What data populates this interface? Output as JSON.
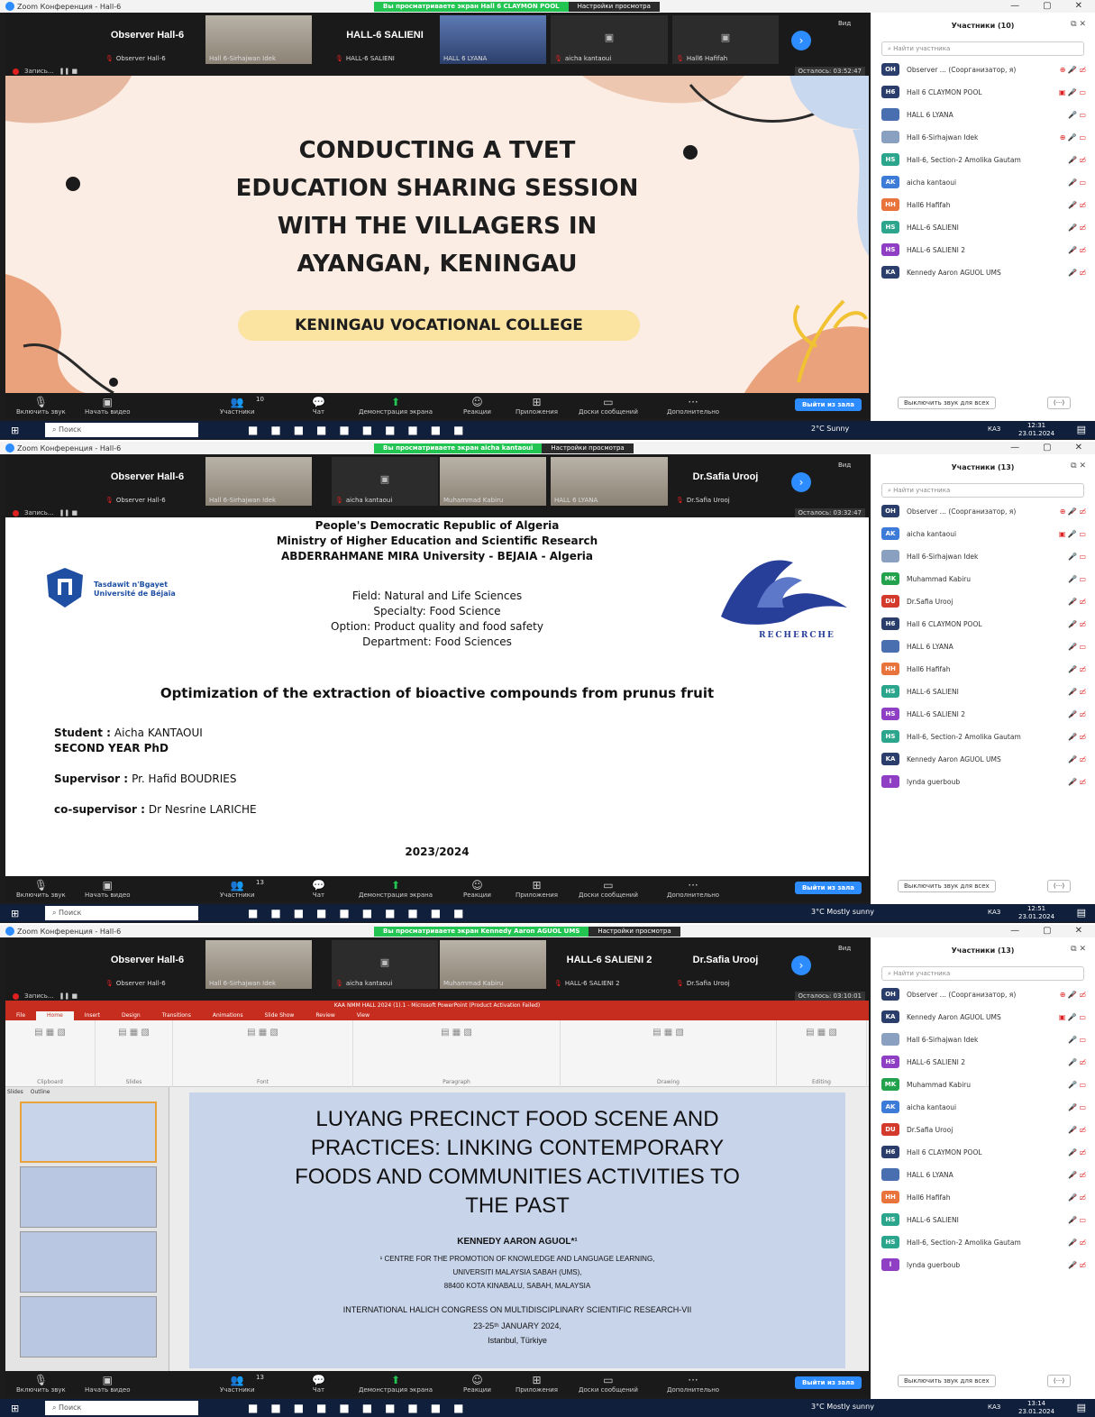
{
  "app_title": "Zoom Конференция - Hall-6",
  "window_controls": [
    "—",
    "▢",
    "✕"
  ],
  "screens": [
    {
      "banner": "Вы просматриваете экран Hall 6 CLAYMON POOL",
      "view_options": "Настройки просмотра",
      "gallery": [
        {
          "name": "Observer Hall-6",
          "sub": "Observer Hall-6",
          "cam": false
        },
        {
          "name": "",
          "sub": "Hall 6-Sirhajwan Idek",
          "cam": true
        },
        {
          "name": "HALL-6 SALIENI",
          "sub": "HALL-6 SALIENI",
          "cam": false
        },
        {
          "name": "",
          "sub": "HALL 6 LYANA",
          "cam": true
        },
        {
          "name": "",
          "sub": "aicha kantaoui",
          "cam": false
        },
        {
          "name": "",
          "sub": "Hall6 Hafifah",
          "cam": false
        }
      ],
      "view_label": "Вид",
      "recording": "Запись...",
      "remaining": "Осталось: 03:52:47",
      "slide": {
        "title_lines": [
          "CONDUCTING A TVET",
          "EDUCATION SHARING SESSION",
          "WITH THE VILLAGERS IN",
          "AYANGAN, KENINGAU"
        ],
        "pill": "KENINGAU VOCATIONAL COLLEGE"
      },
      "participants_title": "Участники (10)",
      "participants": [
        {
          "initials": "OH",
          "color": "#2b3e6b",
          "name": "Observer ... (Соорганизатор, я)",
          "status": "⊕ 🎤̸ ▭̸"
        },
        {
          "initials": "H6",
          "color": "#2b3e6b",
          "name": "Hall 6 CLAYMON POOL",
          "status": "▣ 🎤̸ ▭"
        },
        {
          "initials": "",
          "color": "#4a6fb0",
          "name": "HALL 6 LYANA",
          "status": "🎤 ▭"
        },
        {
          "initials": "",
          "color": "#8aa0c0",
          "name": "Hall 6-Sirhajwan Idek",
          "status": "⊕ 🎤 ▭"
        },
        {
          "initials": "HS",
          "color": "#2ca58d",
          "name": "Hall-6, Section-2 Amolika Gautam",
          "status": "🎤̸ ▭̸"
        },
        {
          "initials": "AK",
          "color": "#3d7bd9",
          "name": "aicha kantaoui",
          "status": "🎤̸ ▭"
        },
        {
          "initials": "HH",
          "color": "#e8743b",
          "name": "Hall6 Hafifah",
          "status": "🎤̸ ▭̸"
        },
        {
          "initials": "HS",
          "color": "#2ca58d",
          "name": "HALL-6 SALIENI",
          "status": "🎤̸ ▭̸"
        },
        {
          "initials": "HS",
          "color": "#8e3fc4",
          "name": "HALL-6 SALIENI 2",
          "status": "🎤̸ ▭̸"
        },
        {
          "initials": "KA",
          "color": "#2b3e6b",
          "name": "Kennedy Aaron AGUOL UMS",
          "status": "🎤̸ ▭̸"
        }
      ],
      "participants_count": "10",
      "weather": "2°C Sunny",
      "time": "12:31",
      "date": "23.01.2024"
    },
    {
      "banner": "Вы просматриваете экран aicha kantaoui",
      "view_options": "Настройки просмотра",
      "gallery": [
        {
          "name": "Observer Hall-6",
          "sub": "Observer Hall-6",
          "cam": false
        },
        {
          "name": "",
          "sub": "Hall 6-Sirhajwan Idek",
          "cam": true
        },
        {
          "name": "",
          "sub": "aicha kantaoui",
          "cam": false
        },
        {
          "name": "",
          "sub": "Muhammad Kabiru",
          "cam": true
        },
        {
          "name": "",
          "sub": "HALL 6 LYANA",
          "cam": true
        },
        {
          "name": "Dr.Safia Urooj",
          "sub": "Dr.Safia Urooj",
          "cam": false
        }
      ],
      "view_label": "Вид",
      "recording": "Запись...",
      "remaining": "Осталось: 03:32:47",
      "slide": {
        "header": [
          "People's Democratic Republic of Algeria",
          "Ministry of Higher Education and Scientific Research",
          "ABDERRAHMANE MIRA University - BEJAIA - Algeria"
        ],
        "logo_text": "Tasdawit n'Bgayet Université de Béjaïa",
        "field": [
          "Field: Natural and Life Sciences",
          "Specialty: Food Science",
          "Option: Product quality and food safety",
          "Department: Food Sciences"
        ],
        "recherche": "RECHERCHE",
        "title": "Optimization of the extraction of bioactive compounds from prunus fruit",
        "student_label": "Student :",
        "student": "Aicha KANTAOUI",
        "year": "SECOND YEAR PhD",
        "supervisor_label": "Supervisor :",
        "supervisor": "Pr. Hafid BOUDRIES",
        "cosupervisor_label": "co-supervisor :",
        "cosupervisor": "Dr Nesrine LARICHE",
        "academic_year": "2023/2024"
      },
      "participants_title": "Участники (13)",
      "participants": [
        {
          "initials": "OH",
          "color": "#2b3e6b",
          "name": "Observer ... (Соорганизатор, я)",
          "status": "⊕ 🎤̸ ▭̸"
        },
        {
          "initials": "AK",
          "color": "#3d7bd9",
          "name": "aicha kantaoui",
          "status": "▣ 🎤 ▭"
        },
        {
          "initials": "",
          "color": "#8aa0c0",
          "name": "Hall 6-Sirhajwan Idek",
          "status": "🎤 ▭"
        },
        {
          "initials": "MK",
          "color": "#23a24d",
          "name": "Muhammad Kabiru",
          "status": "🎤 ▭"
        },
        {
          "initials": "DU",
          "color": "#d33a2c",
          "name": "Dr.Safia Urooj",
          "status": "🎤̸ ▭̸"
        },
        {
          "initials": "H6",
          "color": "#2b3e6b",
          "name": "Hall 6 CLAYMON POOL",
          "status": "🎤̸ ▭̸"
        },
        {
          "initials": "",
          "color": "#4a6fb0",
          "name": "HALL 6 LYANA",
          "status": "🎤̸ ▭"
        },
        {
          "initials": "HH",
          "color": "#e8743b",
          "name": "Hall6 Hafifah",
          "status": "🎤̸ ▭̸"
        },
        {
          "initials": "HS",
          "color": "#2ca58d",
          "name": "HALL-6 SALIENI",
          "status": "🎤̸ ▭̸"
        },
        {
          "initials": "HS",
          "color": "#8e3fc4",
          "name": "HALL-6 SALIENI 2",
          "status": "🎤̸ ▭̸"
        },
        {
          "initials": "HS",
          "color": "#2ca58d",
          "name": "Hall-6, Section-2 Amolika Gautam",
          "status": "🎤̸ ▭̸"
        },
        {
          "initials": "KA",
          "color": "#2b3e6b",
          "name": "Kennedy Aaron AGUOL UMS",
          "status": "🎤̸ ▭̸"
        },
        {
          "initials": "l",
          "color": "#8e3fc4",
          "name": "lynda guerboub",
          "status": "🎤̸ ▭̸"
        }
      ],
      "participants_count": "13",
      "weather": "3°C Mostly sunny",
      "time": "12:51",
      "date": "23.01.2024"
    },
    {
      "banner": "Вы просматриваете экран Kennedy Aaron AGUOL UMS",
      "view_options": "Настройки просмотра",
      "gallery": [
        {
          "name": "Observer Hall-6",
          "sub": "Observer Hall-6",
          "cam": false
        },
        {
          "name": "",
          "sub": "Hall 6-Sirhajwan Idek",
          "cam": true
        },
        {
          "name": "",
          "sub": "aicha kantaoui",
          "cam": false
        },
        {
          "name": "",
          "sub": "Muhammad Kabiru",
          "cam": true
        },
        {
          "name": "HALL-6 SALIENI 2",
          "sub": "HALL-6 SALIENI 2",
          "cam": false
        },
        {
          "name": "Dr.Safia Urooj",
          "sub": "Dr.Safia Urooj",
          "cam": false
        }
      ],
      "view_label": "Вид",
      "recording": "Запись...",
      "remaining": "Осталось: 03:10:01",
      "ppt": {
        "titlebar": "KAA NMM HALL 2024 (1).1 - Microsoft PowerPoint (Product Activation Failed)",
        "tabs": [
          "File",
          "Home",
          "Insert",
          "Design",
          "Transitions",
          "Animations",
          "Slide Show",
          "Review",
          "View"
        ],
        "groups": [
          "Clipboard",
          "Slides",
          "Font",
          "Paragraph",
          "Drawing",
          "Editing"
        ],
        "panes": [
          "Slides",
          "Outline"
        ]
      },
      "slide": {
        "title_lines": [
          "LUYANG PRECINCT FOOD SCENE AND",
          "PRACTICES: LINKING CONTEMPORARY",
          "FOODS AND COMMUNITIES ACTIVITIES TO",
          "THE PAST"
        ],
        "author": "KENNEDY AARON AGUOL*¹",
        "affil": [
          "¹ CENTRE FOR THE PROMOTION OF KNOWLEDGE AND LANGUAGE LEARNING,",
          "UNIVERSITI MALAYSIA SABAH (UMS),",
          "88400 KOTA KINABALU, SABAH, MALAYSIA"
        ],
        "congress": "INTERNATIONAL HALICH CONGRESS ON MULTIDISCIPLINARY SCIENTIFIC RESEARCH-VII",
        "dates": "23-25ᵗʰ JANUARY 2024,",
        "place": "Istanbul, Türkiye"
      },
      "participants_title": "Участники (13)",
      "participants": [
        {
          "initials": "OH",
          "color": "#2b3e6b",
          "name": "Observer ... (Соорганизатор, я)",
          "status": "⊕ 🎤̸ ▭̸"
        },
        {
          "initials": "KA",
          "color": "#2b3e6b",
          "name": "Kennedy Aaron AGUOL UMS",
          "status": "▣ 🎤 ▭"
        },
        {
          "initials": "",
          "color": "#8aa0c0",
          "name": "Hall 6-Sirhajwan Idek",
          "status": "🎤 ▭"
        },
        {
          "initials": "HS",
          "color": "#8e3fc4",
          "name": "HALL-6 SALIENI 2",
          "status": "🎤 ▭̸"
        },
        {
          "initials": "MK",
          "color": "#23a24d",
          "name": "Muhammad Kabiru",
          "status": "🎤 ▭"
        },
        {
          "initials": "AK",
          "color": "#3d7bd9",
          "name": "aicha kantaoui",
          "status": "🎤̸ ▭"
        },
        {
          "initials": "DU",
          "color": "#d33a2c",
          "name": "Dr.Safia Urooj",
          "status": "🎤̸ ▭̸"
        },
        {
          "initials": "H6",
          "color": "#2b3e6b",
          "name": "Hall 6 CLAYMON POOL",
          "status": "🎤̸ ▭̸"
        },
        {
          "initials": "",
          "color": "#4a6fb0",
          "name": "HALL 6 LYANA",
          "status": "🎤̸ ▭̸"
        },
        {
          "initials": "HH",
          "color": "#e8743b",
          "name": "Hall6 Hafifah",
          "status": "🎤̸ ▭̸"
        },
        {
          "initials": "HS",
          "color": "#2ca58d",
          "name": "HALL-6 SALIENI",
          "status": "🎤̸ ▭"
        },
        {
          "initials": "HS",
          "color": "#2ca58d",
          "name": "Hall-6, Section-2 Amolika Gautam",
          "status": "🎤̸ ▭̸"
        },
        {
          "initials": "l",
          "color": "#8e3fc4",
          "name": "lynda guerboub",
          "status": "🎤̸ ▭̸"
        }
      ],
      "participants_count": "13",
      "weather": "3°C Mostly sunny",
      "time": "13:14",
      "date": "23.01.2024"
    }
  ],
  "toolbar": {
    "unmute": "Включить звук",
    "start_video": "Начать видео",
    "participants": "Участники",
    "chat": "Чат",
    "share": "Демонстрация экрана",
    "reactions": "Реакции",
    "apps": "Приложения",
    "whiteboards": "Доски сообщений",
    "more": "Дополнительно",
    "leave": "Выйти из зала"
  },
  "panel": {
    "search_placeholder": "Найти участника",
    "mute_all": "Выключить звук для всех",
    "more": "(···)"
  },
  "taskbar": {
    "search": "Поиск",
    "lang": "КАЗ"
  }
}
